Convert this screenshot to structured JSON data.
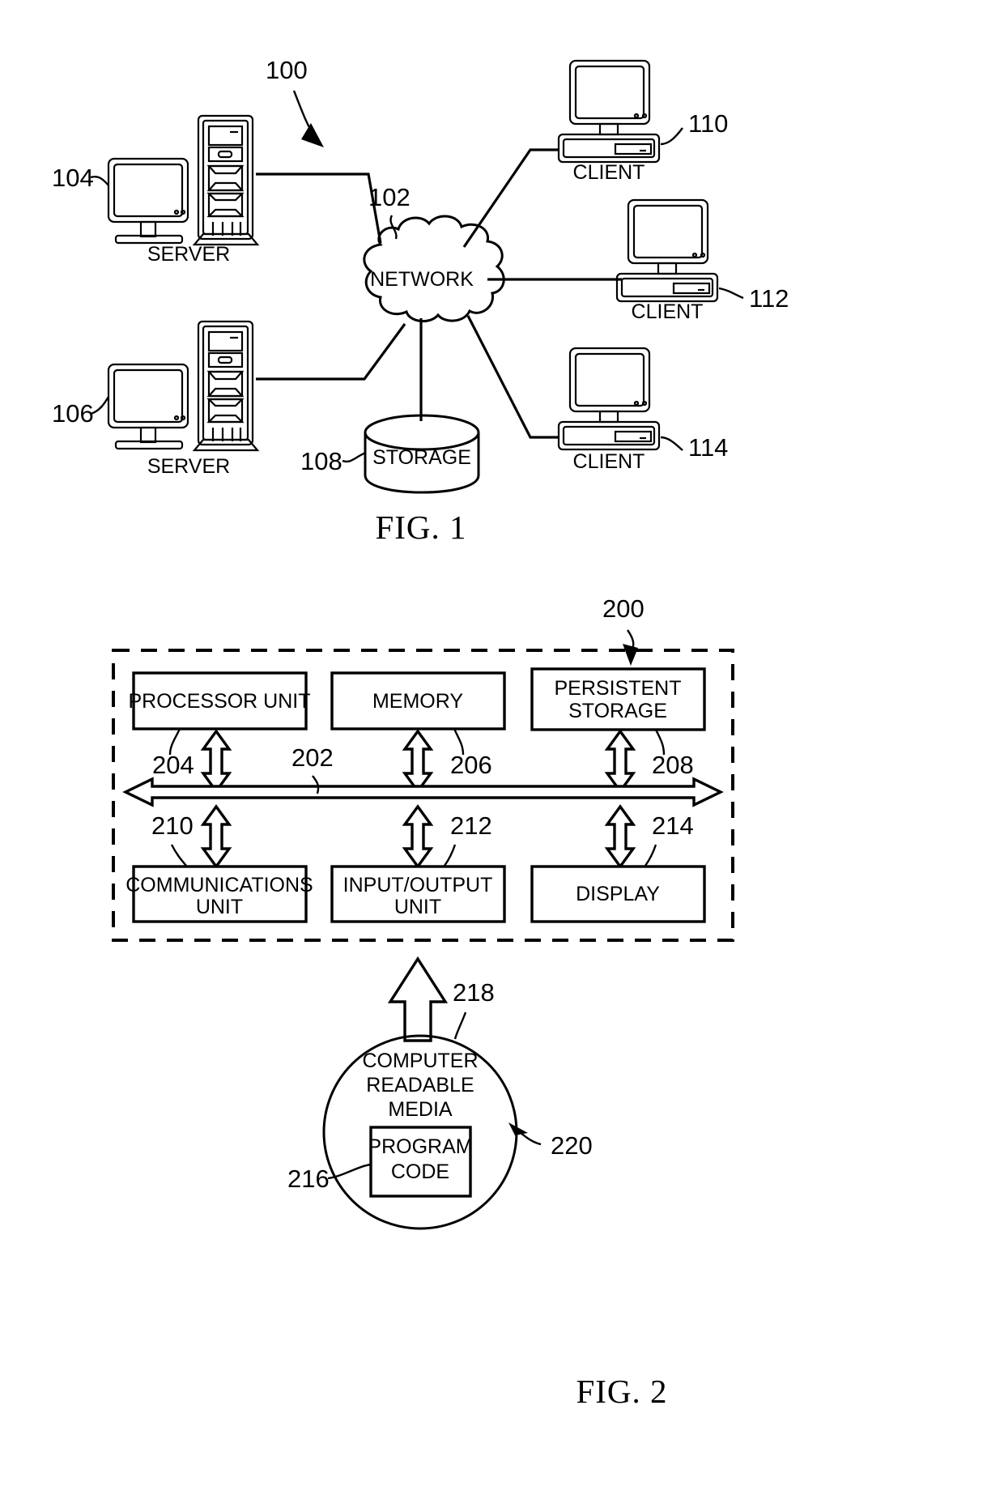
{
  "document": {
    "type": "patent-figure-sheet",
    "figures": [
      {
        "id": "fig1",
        "caption": "FIG. 1",
        "reference": "100",
        "title": "Network data processing system",
        "nodes": [
          {
            "ref": "104",
            "label": "SERVER",
            "kind": "server"
          },
          {
            "ref": "106",
            "label": "SERVER",
            "kind": "server"
          },
          {
            "ref": "102",
            "label": "NETWORK",
            "kind": "cloud"
          },
          {
            "ref": "108",
            "label": "STORAGE",
            "kind": "cylinder"
          },
          {
            "ref": "110",
            "label": "CLIENT",
            "kind": "client"
          },
          {
            "ref": "112",
            "label": "CLIENT",
            "kind": "client"
          },
          {
            "ref": "114",
            "label": "CLIENT",
            "kind": "client"
          }
        ]
      },
      {
        "id": "fig2",
        "caption": "FIG. 2",
        "reference": "200",
        "title": "Data processing system",
        "bus": {
          "ref": "202",
          "label": ""
        },
        "blocks": [
          {
            "ref": "204",
            "label": "PROCESSOR UNIT",
            "row": "top"
          },
          {
            "ref": "206",
            "label": "MEMORY",
            "row": "top"
          },
          {
            "ref": "208",
            "label": "PERSISTENT\nSTORAGE",
            "line1": "PERSISTENT",
            "line2": "STORAGE",
            "row": "top"
          },
          {
            "ref": "210",
            "line1": "COMMUNICATIONS",
            "line2": "UNIT",
            "row": "bottom"
          },
          {
            "ref": "212",
            "line1": "INPUT/OUTPUT",
            "line2": "UNIT",
            "row": "bottom"
          },
          {
            "ref": "214",
            "line1": "DISPLAY",
            "line2": "",
            "row": "bottom"
          }
        ],
        "media": {
          "ref": "218",
          "line1": "COMPUTER",
          "line2": "READABLE",
          "line3": "MEDIA",
          "program": {
            "ref": "216",
            "line1": "PROGRAM",
            "line2": "CODE"
          },
          "product_ref": "220"
        }
      }
    ]
  },
  "fig1": {
    "caption": "FIG. 1",
    "ref_system": "100",
    "ref_network": "102",
    "ref_server_top": "104",
    "ref_server_bottom": "106",
    "ref_storage": "108",
    "ref_client_top": "110",
    "ref_client_mid": "112",
    "ref_client_bottom": "114",
    "label_network": "NETWORK",
    "label_storage": "STORAGE",
    "label_server_top": "SERVER",
    "label_server_bottom": "SERVER",
    "label_client_top": "CLIENT",
    "label_client_mid": "CLIENT",
    "label_client_bottom": "CLIENT"
  },
  "fig2": {
    "caption": "FIG. 2",
    "ref_system": "200",
    "ref_bus": "202",
    "ref_processor": "204",
    "ref_memory": "206",
    "ref_persistent": "208",
    "ref_comm": "210",
    "ref_io": "212",
    "ref_display": "214",
    "ref_program_code": "216",
    "ref_media": "218",
    "ref_product": "220",
    "label_processor": "PROCESSOR UNIT",
    "label_memory": "MEMORY",
    "label_persistent_1": "PERSISTENT",
    "label_persistent_2": "STORAGE",
    "label_comm_1": "COMMUNICATIONS",
    "label_comm_2": "UNIT",
    "label_io_1": "INPUT/OUTPUT",
    "label_io_2": "UNIT",
    "label_display": "DISPLAY",
    "label_media_1": "COMPUTER",
    "label_media_2": "READABLE",
    "label_media_3": "MEDIA",
    "label_program_1": "PROGRAM",
    "label_program_2": "CODE"
  },
  "colors": {
    "ink": "#000000",
    "paper": "#ffffff"
  }
}
